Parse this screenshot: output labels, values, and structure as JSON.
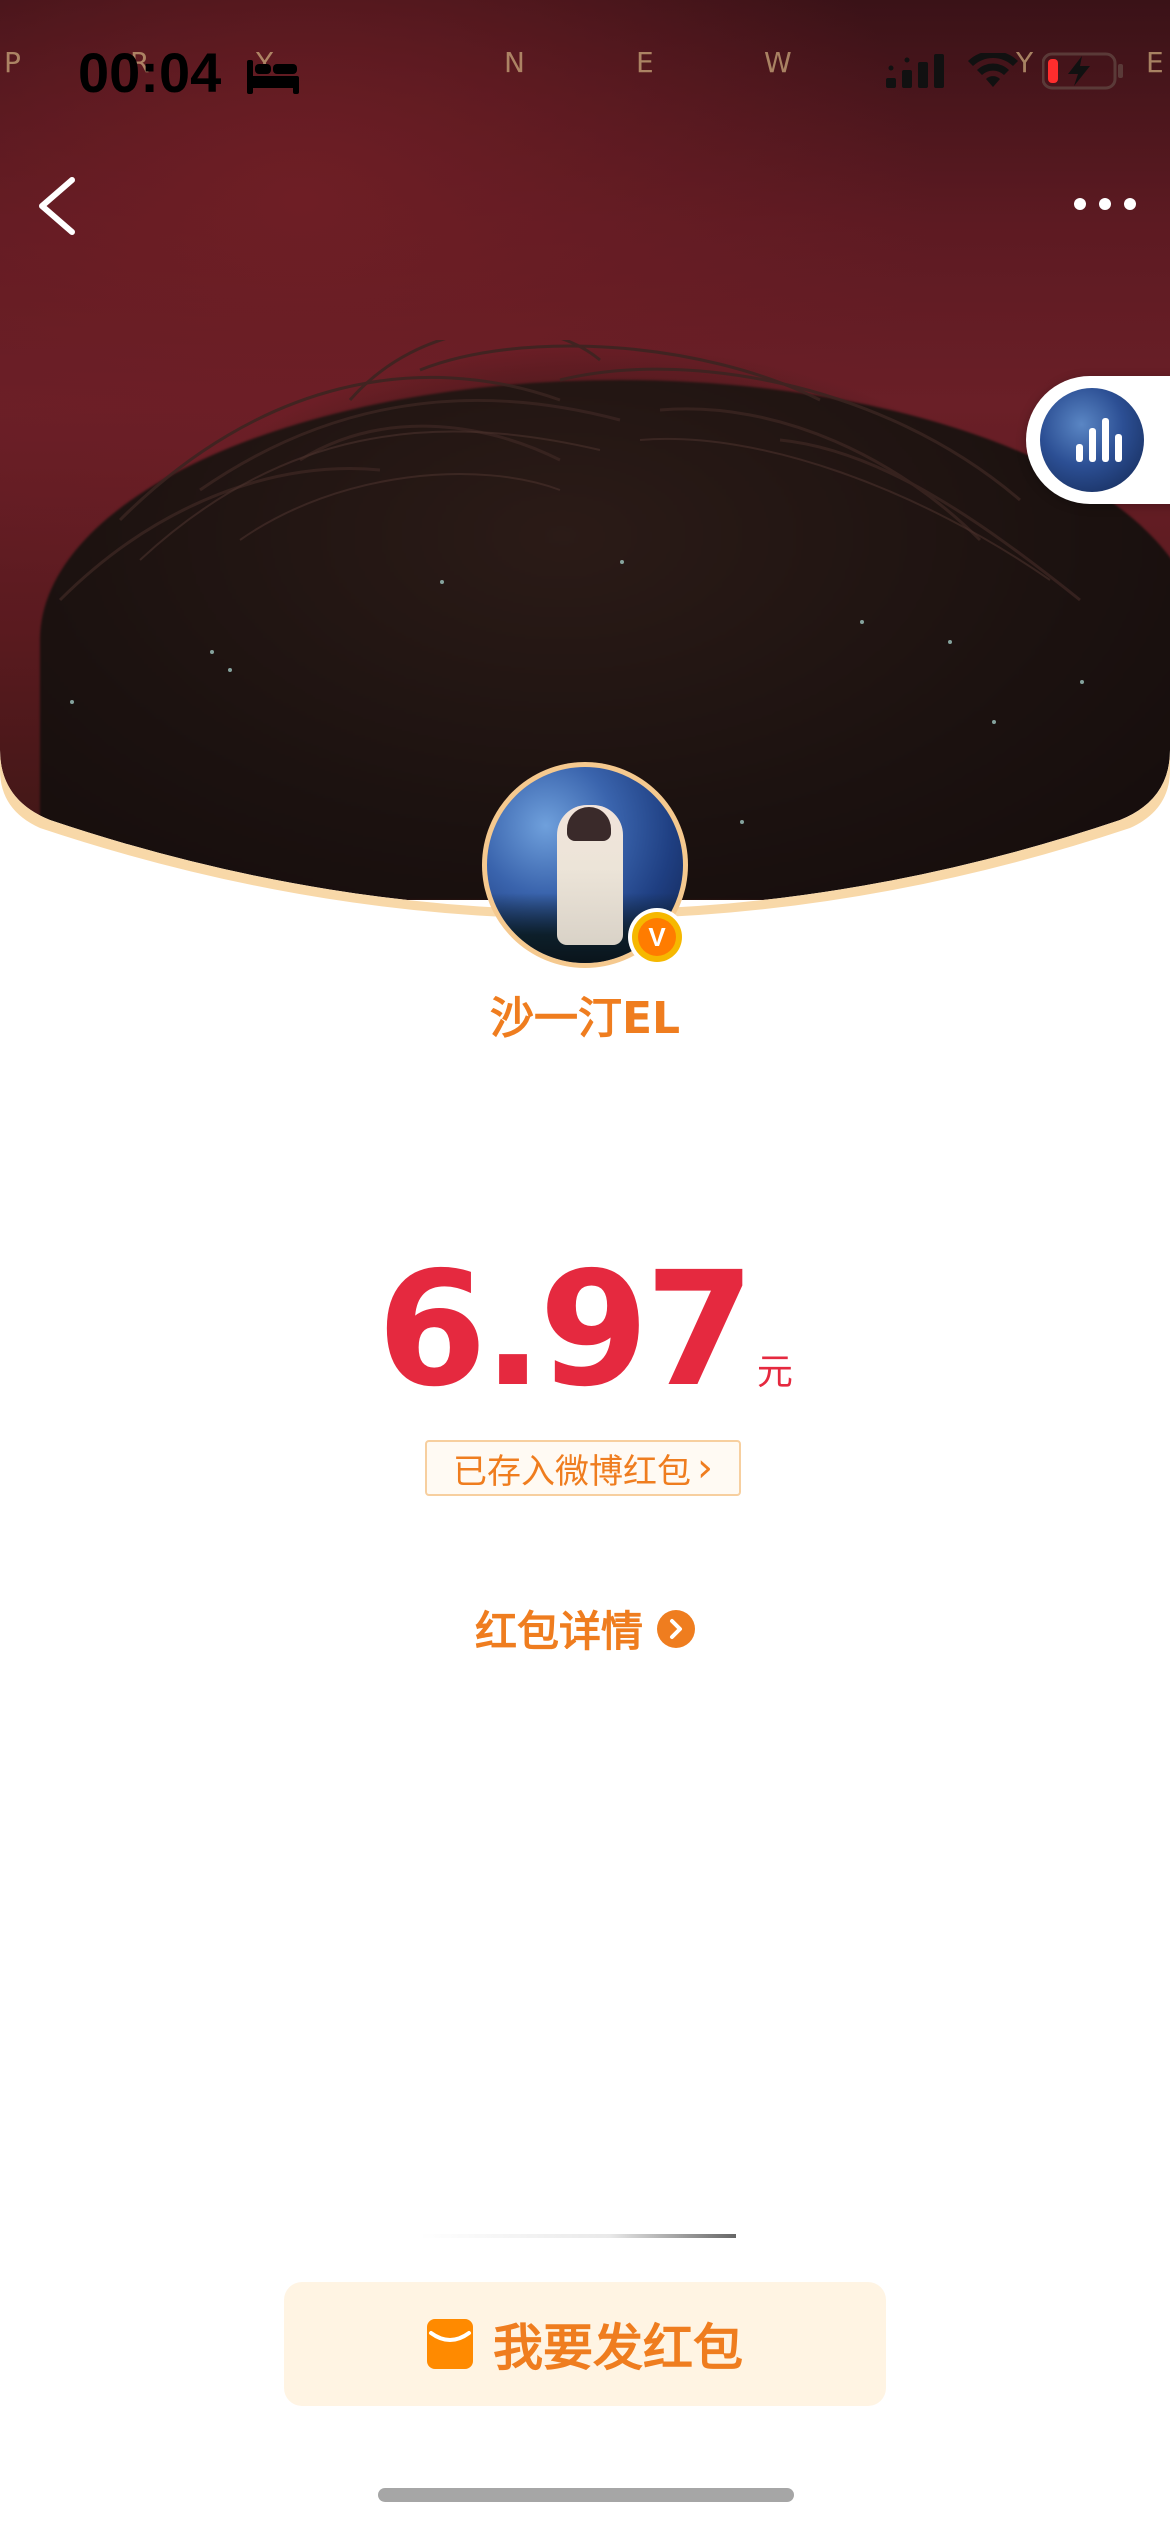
{
  "status_bar": {
    "time": "00:04",
    "watermark_letters": [
      "P",
      "R",
      "Y",
      "N",
      "E",
      "W",
      "Y",
      "E"
    ]
  },
  "nav": {
    "back_icon": "chevron-left-icon",
    "more_icon": "more-horizontal-icon"
  },
  "live_bubble": {
    "icon": "live-bars-icon"
  },
  "profile": {
    "name": "沙一汀EL",
    "verified_badge": "V"
  },
  "amount": {
    "value": "6.97",
    "unit": "元",
    "saved_label": "已存入微博红包",
    "saved_chevron": "›"
  },
  "details": {
    "label": "红包详情"
  },
  "send_button": {
    "label": "我要发红包"
  },
  "colors": {
    "accent_orange": "#ef7d1f",
    "amount_red": "#e5293f",
    "button_bg": "#fff4e3",
    "badge_gold": "#f6b800"
  }
}
